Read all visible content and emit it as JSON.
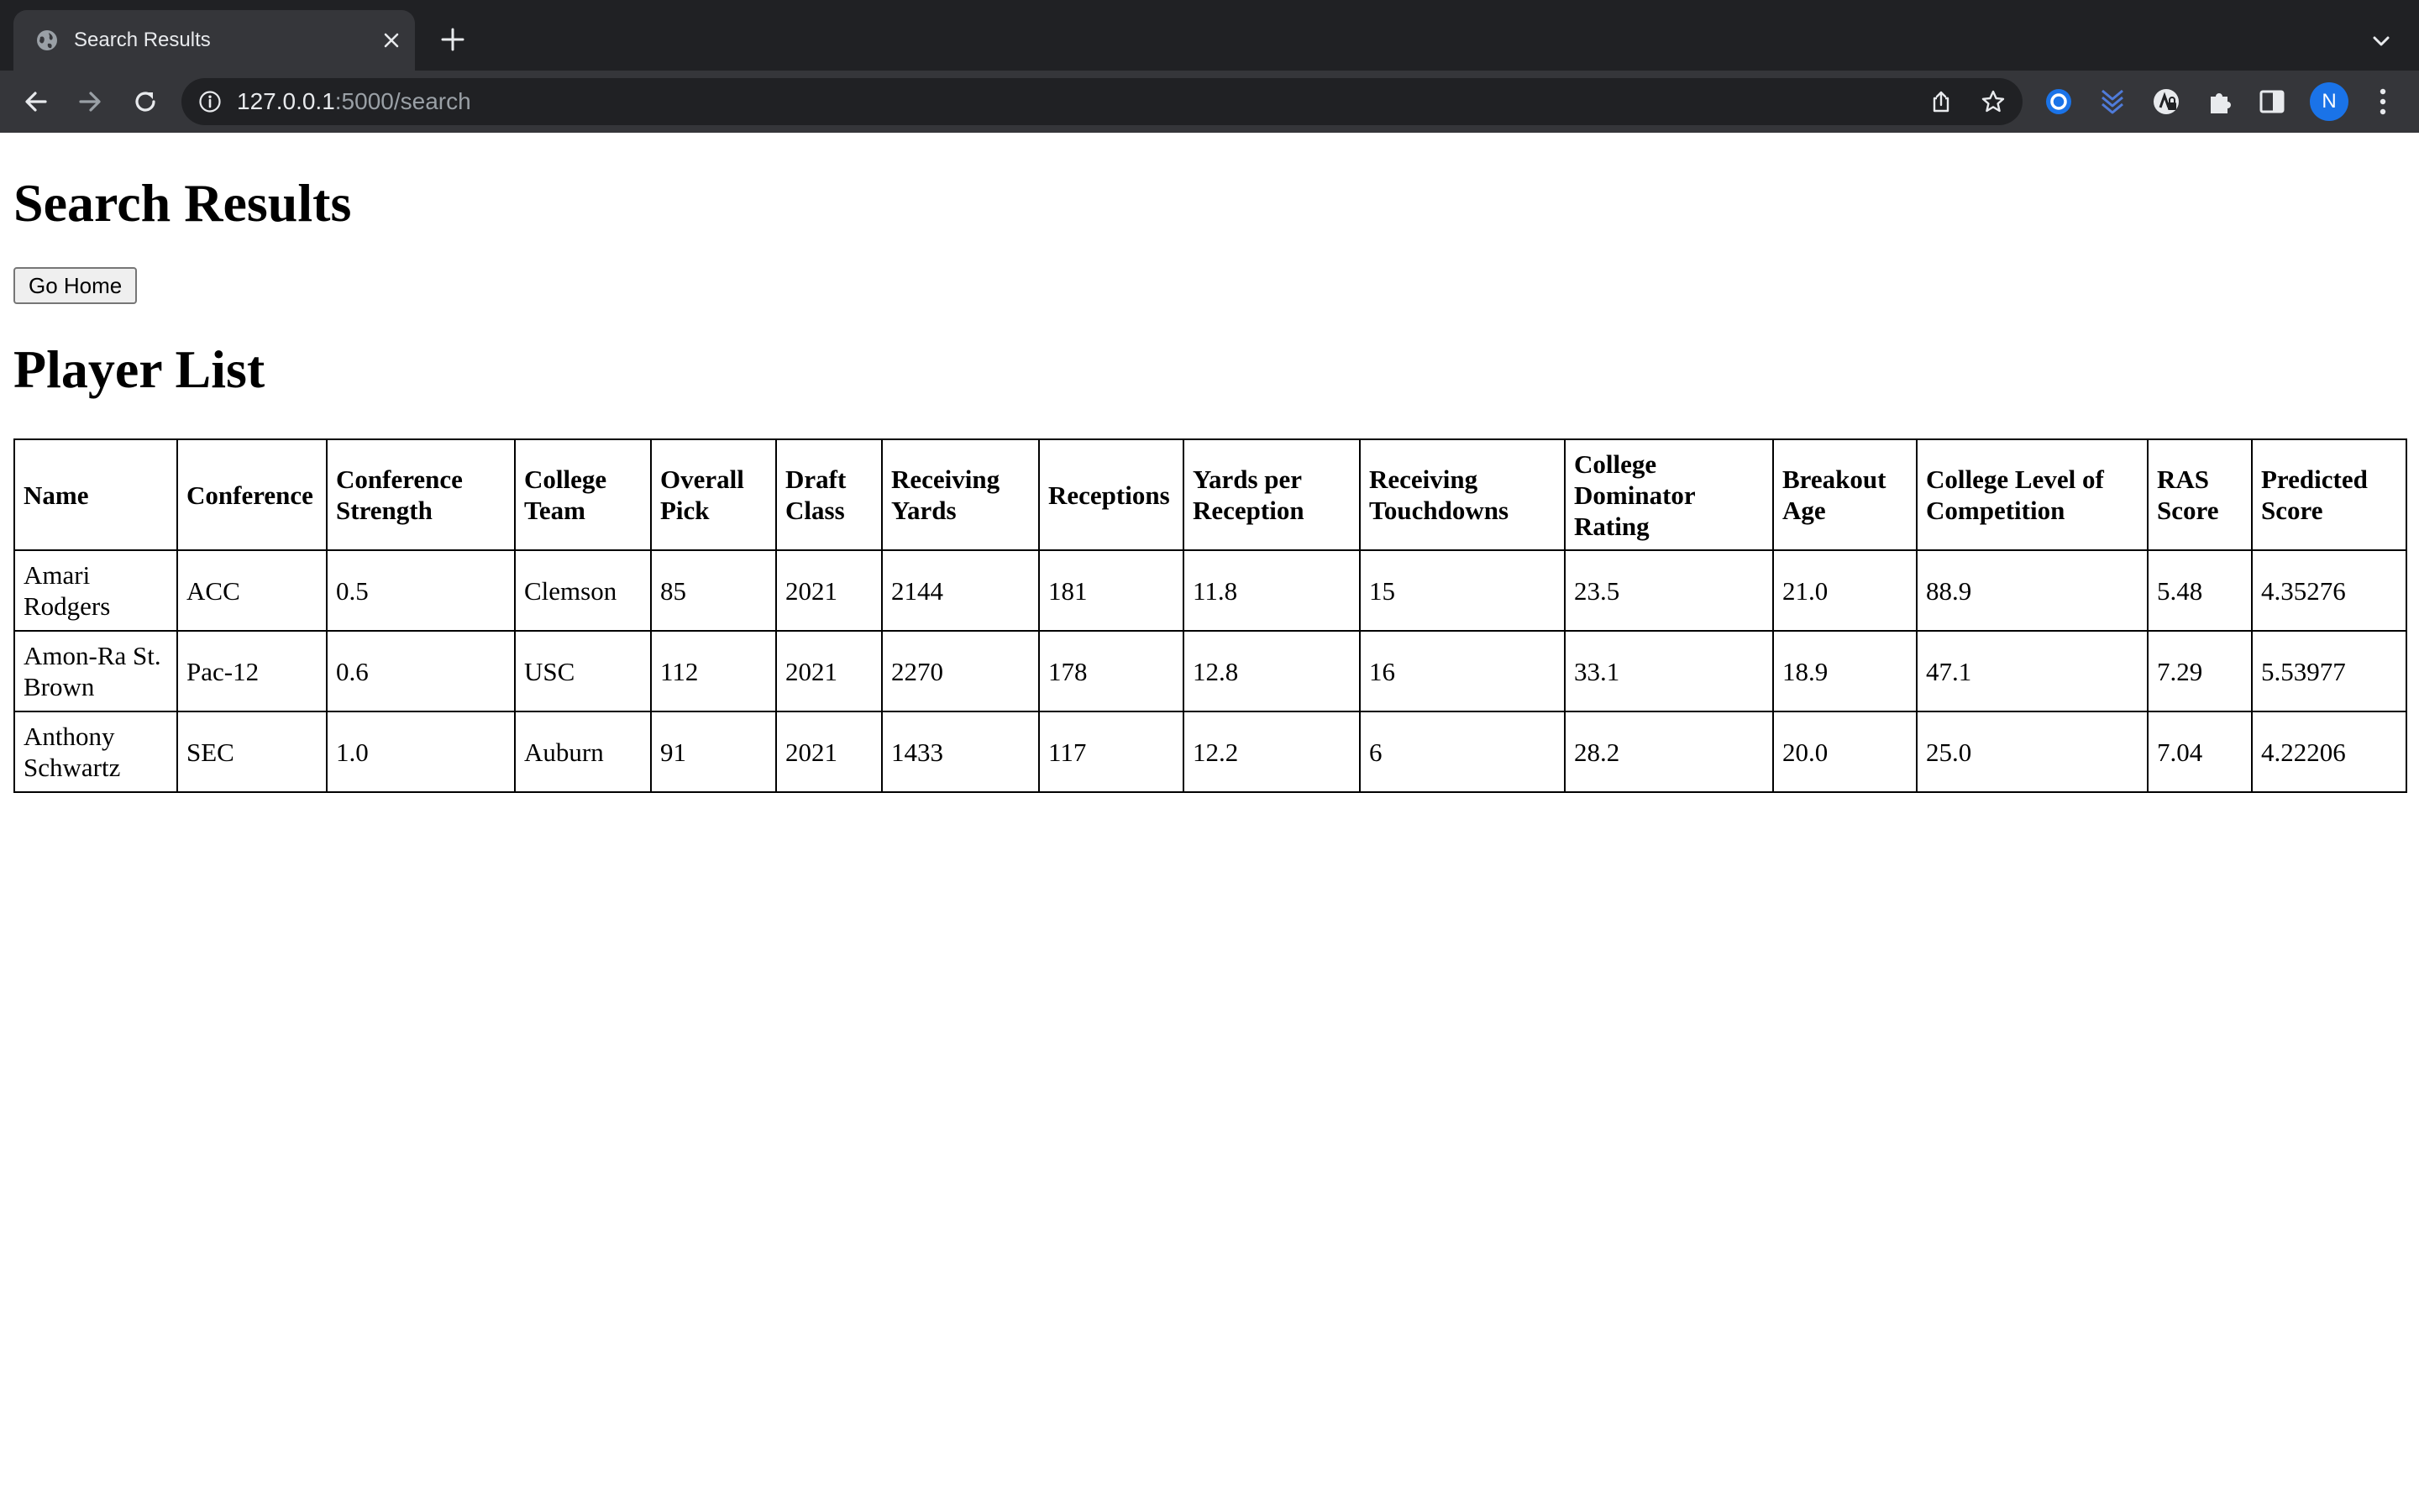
{
  "browser": {
    "tab_title": "Search Results",
    "url_host": "127.0.0.1",
    "url_path": ":5000/search",
    "profile_initial": "N"
  },
  "page": {
    "title": "Search Results",
    "home_button": "Go Home",
    "subtitle": "Player List"
  },
  "table": {
    "headers": [
      "Name",
      "Conference",
      "Conference Strength",
      "College Team",
      "Overall Pick",
      "Draft Class",
      "Receiving Yards",
      "Receptions",
      "Yards per Reception",
      "Receiving Touchdowns",
      "College Dominator Rating",
      "Breakout Age",
      "College Level of Competition",
      "RAS Score",
      "Predicted Score"
    ],
    "rows": [
      [
        "Amari Rodgers",
        "ACC",
        "0.5",
        "Clemson",
        "85",
        "2021",
        "2144",
        "181",
        "11.8",
        "15",
        "23.5",
        "21.0",
        "88.9",
        "5.48",
        "4.35276"
      ],
      [
        "Amon-Ra St. Brown",
        "Pac-12",
        "0.6",
        "USC",
        "112",
        "2021",
        "2270",
        "178",
        "12.8",
        "16",
        "33.1",
        "18.9",
        "47.1",
        "7.29",
        "5.53977"
      ],
      [
        "Anthony Schwartz",
        "SEC",
        "1.0",
        "Auburn",
        "91",
        "2021",
        "1433",
        "117",
        "12.2",
        "6",
        "28.2",
        "20.0",
        "25.0",
        "7.04",
        "4.22206"
      ]
    ]
  }
}
